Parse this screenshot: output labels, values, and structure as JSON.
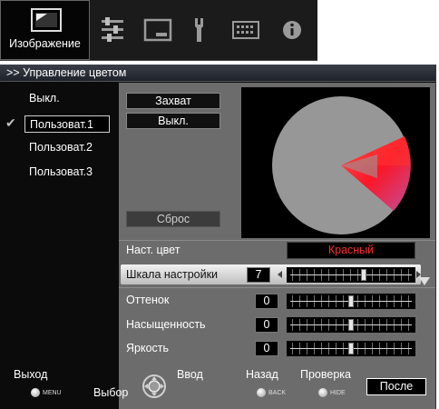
{
  "topbar": {
    "active_tab_label": "Изображение",
    "tabs": [
      {
        "icon": "picture-icon"
      },
      {
        "icon": "adjust-settings-icon"
      },
      {
        "icon": "screen-icon"
      },
      {
        "icon": "wrench-icon"
      },
      {
        "icon": "keyboard-icon"
      },
      {
        "icon": "info-icon"
      }
    ]
  },
  "panel": {
    "title": ">> Управление цветом",
    "presets": [
      {
        "label": "Выкл.",
        "selected": false
      },
      {
        "label": "Пользоват.1",
        "selected": true
      },
      {
        "label": "Пользоват.2",
        "selected": false
      },
      {
        "label": "Пользоват.3",
        "selected": false
      }
    ],
    "capture_button": "Захват",
    "off_button": "Выкл.",
    "reset_button": "Сброс",
    "color_wheel": {
      "highlight_color": "Красный",
      "accent": "#ff2020"
    },
    "rows": {
      "adjust_color": {
        "label": "Наст. цвет",
        "value": "Красный"
      },
      "scale": {
        "label": "Шкала настройки",
        "value": "7",
        "level": 7,
        "max": 10
      },
      "hue": {
        "label": "Оттенок",
        "value": "0",
        "level": 0
      },
      "saturation": {
        "label": "Насыщенность",
        "value": "0",
        "level": 0
      },
      "brightness": {
        "label": "Яркость",
        "value": "0",
        "level": 0
      }
    }
  },
  "bottom": {
    "exit": {
      "label": "Выход",
      "key": "MENU"
    },
    "select": {
      "label": "Выбор"
    },
    "enter": {
      "label": "Ввод"
    },
    "back": {
      "label": "Назад",
      "key": "BACK"
    },
    "check": {
      "label": "Проверка",
      "key": "HIDE"
    },
    "next": {
      "label": "После"
    }
  }
}
